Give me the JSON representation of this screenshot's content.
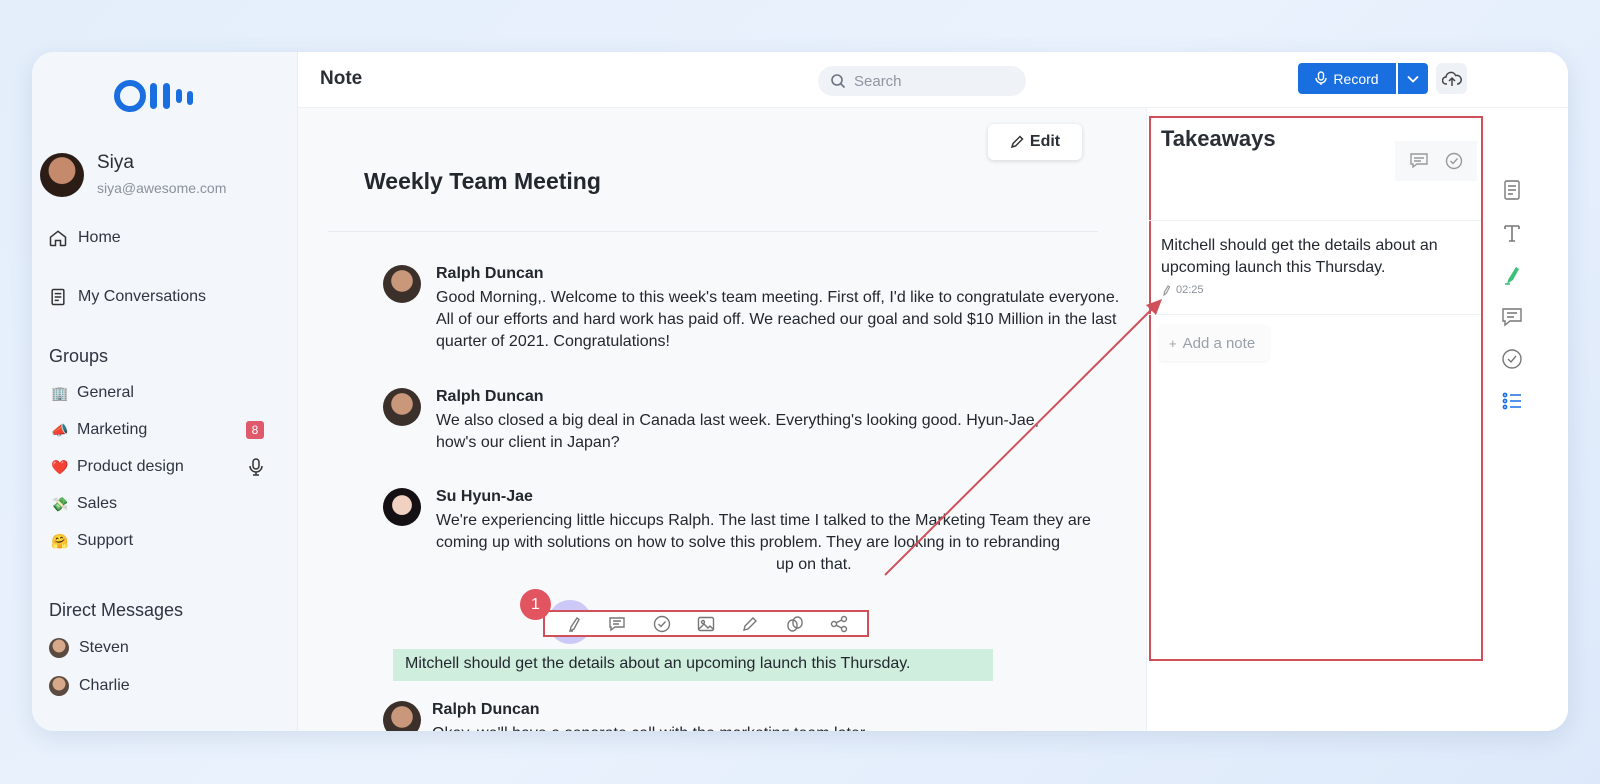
{
  "app": {
    "logo": "Otter"
  },
  "user": {
    "name": "Siya",
    "email": "siya@awesome.com"
  },
  "nav": [
    {
      "label": "Home",
      "icon": "home-icon"
    },
    {
      "label": "My Conversations",
      "icon": "document-icon"
    }
  ],
  "groups": {
    "title": "Groups",
    "items": [
      {
        "emoji": "🏢",
        "label": "General"
      },
      {
        "emoji": "📣",
        "label": "Marketing",
        "badge": "8"
      },
      {
        "emoji": "❤️",
        "label": "Product design",
        "icon": "mic-icon"
      },
      {
        "emoji": "💸",
        "label": "Sales"
      },
      {
        "emoji": "🤗",
        "label": "Support"
      }
    ]
  },
  "direct_messages": {
    "title": "Direct Messages",
    "items": [
      {
        "label": "Steven"
      },
      {
        "label": "Charlie"
      }
    ]
  },
  "header": {
    "title": "Note",
    "search_placeholder": "Search",
    "record_label": "Record"
  },
  "main": {
    "edit_label": "Edit",
    "meeting_title": "Weekly Team Meeting",
    "messages": [
      {
        "speaker": "Ralph Duncan",
        "text": "Good Morning,. Welcome to this week's team meeting. First off, I'd like to congratulate everyone. All of our efforts and hard work has paid off. We reached our goal and sold $10 Million in the last quarter of 2021. Congratulations!"
      },
      {
        "speaker": "Ralph Duncan",
        "text": "We also closed a big deal in Canada last week. Everything's looking good. Hyun-Jae, how's our client in Japan?"
      },
      {
        "speaker": "Su Hyun-Jae",
        "text": "We're experiencing little hiccups Ralph. The last time I talked to the Marketing Team they are coming up with solutions on how to solve this problem. They are looking in to rebranding",
        "text_tail": "up on that."
      },
      {
        "speaker": "Ralph Duncan",
        "text": "Okay, we'll have a separate call with the marketing team later."
      }
    ],
    "highlight": "Mitchell should get the details about an upcoming launch this Thursday.",
    "step_number": "1"
  },
  "takeaways": {
    "title": "Takeaways",
    "item_text": "Mitchell should get the details about an upcoming launch this Thursday.",
    "item_time": "02:25",
    "add_note": "Add a note"
  },
  "colors": {
    "accent": "#1a6fe0",
    "annotation": "#d0505a",
    "highlight": "#cfeedd",
    "badge": "#e05a6b"
  }
}
